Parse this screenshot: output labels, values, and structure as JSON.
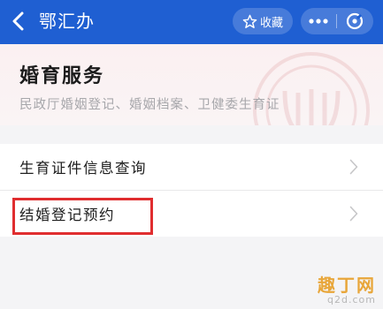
{
  "header": {
    "title": "鄂汇办",
    "favorite_label": "收藏",
    "back_icon": "chevron-left-icon",
    "favorite_icon": "star-icon",
    "more_icon": "more-dots-icon",
    "close_icon": "close-circle-icon",
    "bg_color": "#1f5fd2"
  },
  "banner": {
    "title": "婚育服务",
    "subtitle": "民政厅婚姻登记、婚姻档案、卫健委生育证",
    "emblem_icon": "emblem-icon"
  },
  "list": {
    "items": [
      {
        "label": "生育证件信息查询"
      },
      {
        "label": "结婚登记预约"
      }
    ],
    "chevron_icon": "chevron-right-icon"
  },
  "watermark": {
    "line1": "趣丁网",
    "line2": "q2d.com"
  },
  "colors": {
    "highlight": "#e02d2f"
  }
}
